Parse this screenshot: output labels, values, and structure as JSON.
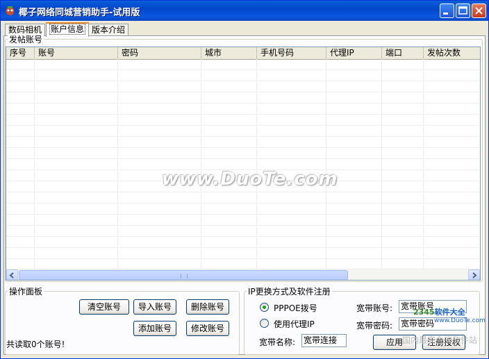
{
  "window": {
    "title": "椰子网络同城营销助手-试用版",
    "icon": "app-icon",
    "controls": {
      "minimize": "minimize-icon",
      "maximize": "maximize-icon",
      "close": "close-icon"
    }
  },
  "tabs": [
    {
      "label": "数码相机",
      "active": false
    },
    {
      "label": "账户信息",
      "active": true
    },
    {
      "label": "版本介绍",
      "active": false
    }
  ],
  "accounts_group": {
    "label": "发帖账号",
    "columns": [
      "序号",
      "账号",
      "密码",
      "城市",
      "手机号码",
      "代理IP",
      "端口",
      "发帖次数"
    ],
    "rows": []
  },
  "operation_panel": {
    "label": "操作面板",
    "buttons": {
      "clear": "清空账号",
      "import": "导入账号",
      "delete": "删除账号",
      "add": "添加账号",
      "edit": "修改账号"
    },
    "status": "共读取0个账号!"
  },
  "ip_panel": {
    "label": "IP更换方式及软件注册",
    "radio_pppoe": "PPPOE拨号",
    "radio_proxy": "使用代理IP",
    "selected": "PPPOE拨号",
    "broadband_name_label": "宽带名称:",
    "broadband_name_value": "宽带连接",
    "broadband_account_label": "宽带账号:",
    "broadband_account_value": "宽带账号",
    "broadband_password_label": "宽带密码:",
    "broadband_password_value": "宽带密码",
    "apply_button": "应用",
    "register_button": "注册授权"
  },
  "watermark": {
    "text": "www.DuoTe.com",
    "brand_part1": "2345",
    "brand_part2": "软件大全",
    "brand_url": "www.DuoTe.com",
    "brand_sub": "国内最安全的软件站"
  },
  "colors": {
    "titlebar": "#0a5fd8",
    "tab_active_accent": "#e68b2c",
    "radio_dot": "#21a121"
  }
}
